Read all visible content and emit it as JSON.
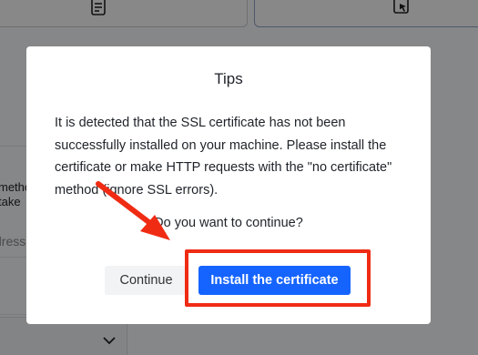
{
  "background": {
    "method_text": "metho",
    "take_text": "take",
    "address_placeholder": "dress",
    "icons": [
      "document-list-icon",
      "cursor-click-icon",
      "chevron-down-icon"
    ]
  },
  "dialog": {
    "title": "Tips",
    "message": "It is detected that the SSL certificate has not been successfully installed on your machine. Please install the certificate or make HTTP requests with the \"no certificate\" method (ignore SSL errors).",
    "question": "Do you want to continue?",
    "continue_label": "Continue",
    "install_label": "Install the certificate"
  },
  "colors": {
    "primary": "#1664ff",
    "annotation": "#f02b14",
    "overlay": "rgba(0,0,0,0.45)"
  }
}
